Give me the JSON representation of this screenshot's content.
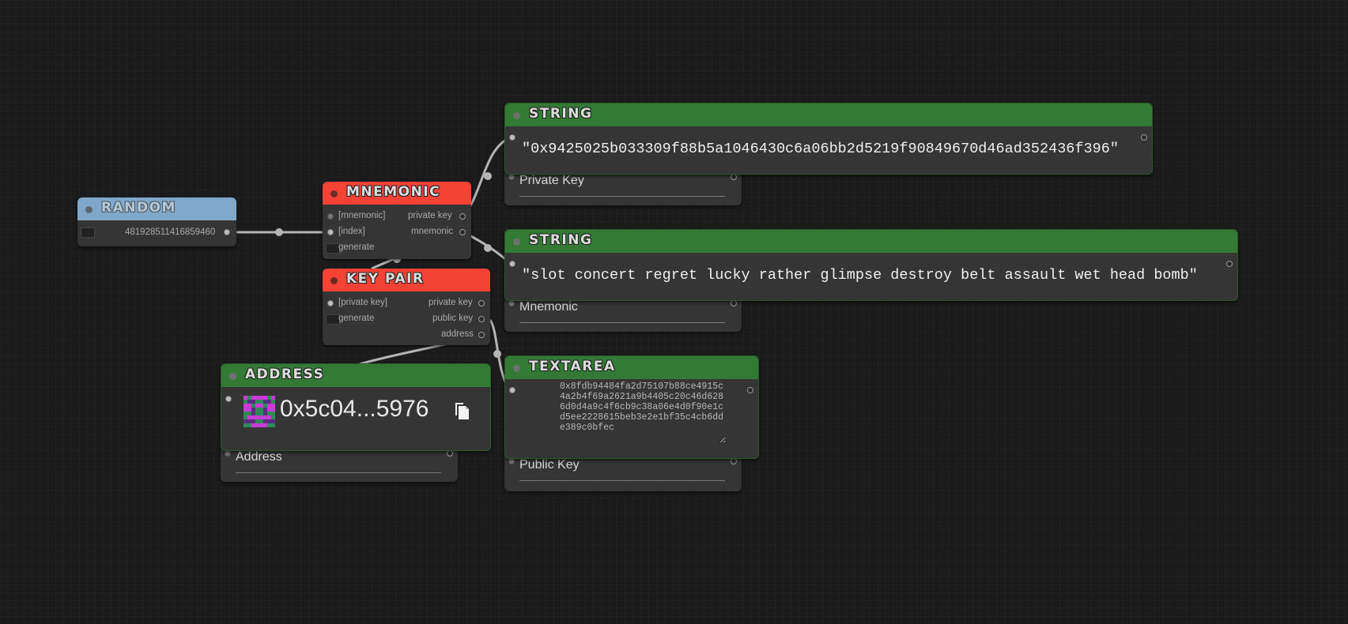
{
  "nodes": {
    "random": {
      "title": "RANDOM",
      "value": "481928511416859460"
    },
    "mnemonic": {
      "title": "MNEMONIC",
      "inputs": [
        "[mnemonic]",
        "[index]"
      ],
      "outputs": [
        "private key",
        "mnemonic"
      ],
      "generate": "generate"
    },
    "keypair": {
      "title": "KEY  PAIR",
      "inputs": [
        "[private key]"
      ],
      "outputs": [
        "private key",
        "public key",
        "address"
      ],
      "generate": "generate"
    },
    "string1": {
      "title": "STRING",
      "value": "\"0x9425025b033309f88b5a1046430c6a06bb2d5219f90849670d46ad352436f396\"",
      "label": "Private Key"
    },
    "string2": {
      "title": "STRING",
      "value": "\"slot concert regret lucky rather glimpse destroy belt assault wet head bomb\"",
      "label": "Mnemonic"
    },
    "textarea": {
      "title": "TEXTAREA",
      "value": "0x8fdb94484fa2d75107b88ce4915c4a2b4f69a2621a9b4405c20c46d6286d0d4a9c4f6cb9c38a06e4d0f90e1cd5ee2228615beb3e2e1bf35c4cb6dde389c0bfec",
      "label": "Public Key"
    },
    "address": {
      "title": "ADDRESS",
      "value": "0x5c04...5976",
      "label": "Address"
    }
  },
  "colors": {
    "green_header": "#337a35",
    "red_header": "#f44336",
    "blue_header": "#7ea7c9",
    "canvas": "#1b1b1b",
    "node_body": "#353535"
  },
  "icons": {
    "copy": "copy-icon",
    "identicon": "blockie-avatar"
  }
}
